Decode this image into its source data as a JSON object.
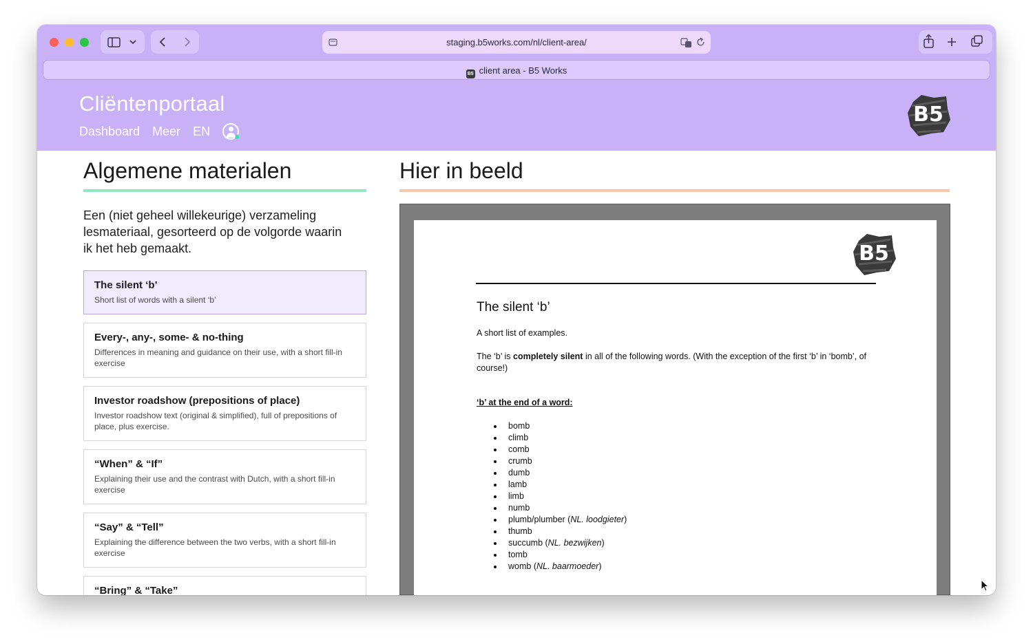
{
  "browser": {
    "url": "staging.b5works.com/nl/client-area/",
    "tab_title": "client area - B5 Works"
  },
  "site": {
    "title": "Cliëntenportaal",
    "nav": [
      "Dashboard",
      "Meer",
      "EN"
    ],
    "logo_text": "B5"
  },
  "left": {
    "heading": "Algemene materialen",
    "intro": "Een (niet geheel willekeurige) verzameling lesmateriaal, gesorteerd op de volgorde waarin ik het heb gemaakt.",
    "items": [
      {
        "title": "The silent ‘b’",
        "desc": "Short list of words with a silent ‘b’"
      },
      {
        "title": "Every-, any-, some- & no-thing",
        "desc": "Differences in meaning and guidance on their use, with a short fill-in exercise"
      },
      {
        "title": "Investor roadshow (prepositions of place)",
        "desc": "Investor roadshow text (original & simplified), full of prepositions of place, plus exercise."
      },
      {
        "title": "“When” & “If”",
        "desc": "Explaining their use and the contrast with Dutch, with a short fill-in exercise"
      },
      {
        "title": "“Say” & “Tell”",
        "desc": "Explaining the difference between the two verbs, with a short fill-in exercise"
      },
      {
        "title": "“Bring” & “Take”",
        "desc": ""
      }
    ]
  },
  "right": {
    "heading": "Hier in beeld"
  },
  "document": {
    "logo_text": "B5",
    "title": "The silent ‘b’",
    "intro": "A short list of examples.",
    "para_before": "The ‘b’ is ",
    "para_bold": "completely silent",
    "para_after": " in all of the following words. (With the exception of the first ‘b’ in ‘bomb’, of course!)",
    "subheading": "‘b’ at the end of a word:",
    "words": [
      {
        "word": "bomb",
        "note": ""
      },
      {
        "word": "climb",
        "note": ""
      },
      {
        "word": "comb",
        "note": ""
      },
      {
        "word": "crumb",
        "note": ""
      },
      {
        "word": "dumb",
        "note": ""
      },
      {
        "word": "lamb",
        "note": ""
      },
      {
        "word": "limb",
        "note": ""
      },
      {
        "word": "numb",
        "note": ""
      },
      {
        "word": "plumb/plumber",
        "note": "NL. loodgieter"
      },
      {
        "word": "thumb",
        "note": ""
      },
      {
        "word": "succumb",
        "note": "NL. bezwijken"
      },
      {
        "word": "tomb",
        "note": ""
      },
      {
        "word": "womb",
        "note": "NL. baarmoeder"
      }
    ]
  }
}
